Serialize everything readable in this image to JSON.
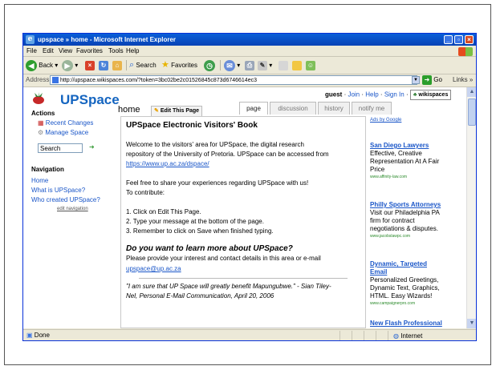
{
  "window": {
    "title": "upspace » home - Microsoft Internet Explorer",
    "controls": [
      "_",
      "▫",
      "×"
    ]
  },
  "menu": [
    "File",
    "Edit",
    "View",
    "Favorites",
    "Tools",
    "Help"
  ],
  "toolbar": {
    "back_label": "Back",
    "search_label": "Search",
    "favorites_label": "Favorites"
  },
  "address": {
    "label": "Address",
    "url": "http://upspace.wikispaces.com/?token=3bc02be2c01526845c873d6746614ec3",
    "go_label": "Go",
    "links_label": "Links »"
  },
  "site": {
    "logo_text": "UPSpace",
    "user": "guest",
    "user_links": [
      "Join",
      "Help",
      "Sign In"
    ],
    "wikispaces_badge": "wikispaces"
  },
  "page": {
    "name": "home",
    "edit_button": "Edit This Page",
    "tabs": [
      "page",
      "discussion",
      "history",
      "notify me"
    ]
  },
  "sidebar": {
    "actions_title": "Actions",
    "actions": [
      "Recent Changes",
      "Manage Space"
    ],
    "search_placeholder": "Search",
    "nav_title": "Navigation",
    "nav_items": [
      "Home",
      "What is UPSpace?",
      "Who created UPSpace?"
    ],
    "edit_nav": "edit navigation"
  },
  "content": {
    "title": "UPSpace Electronic Visitors' Book",
    "p1_l1": "Welcome to the visitors' area for UPSpace, the digital research",
    "p1_l2": "repository of the University of Pretoria. UPSpace can be accessed from",
    "p1_link": "https://www.up.ac.za/dspace/",
    "p2_l1": "Feel free to share your experiences regarding UPSpace with us!",
    "p2_l2": "To contribute:",
    "steps": [
      "1. Click on Edit This Page.",
      "2. Type your message at the bottom of the page.",
      "3. Remember to click on Save when finished typing."
    ],
    "h2": "Do you want to learn more about UPSpace?",
    "p3_l1": "Please provide your interest and contact details in this area or e-mail",
    "p3_link": "upspace@up.ac.za",
    "quote_l1": "\"I am sure that UP Space will greatly benefit Mapungubwe.\" - Sian Tiley-",
    "quote_l2": "Nel, Personal E-Mail Communication, April 20, 2006"
  },
  "ads": {
    "by": "Ads by Google",
    "items": [
      {
        "head": "San Diego Lawyers",
        "lines": [
          "Effective, Creative",
          "Representation At A Fair",
          "Price"
        ],
        "url": "www.affinity-law.com"
      },
      {
        "head": "Philly Sports Attorneys",
        "lines": [
          "Visit our Philadelphia PA",
          "firm for contract",
          "negotiations & disputes."
        ],
        "url": "www.jacobslawpc.com"
      },
      {
        "head_lines": [
          "Dynamic, Targeted",
          "Email"
        ],
        "lines": [
          "Personalized Greetings,",
          "Dynamic Text, Graphics,",
          "HTML. Easy Wizards!"
        ],
        "url": "www.campaignerpro.com"
      },
      {
        "head": "New Flash Professional"
      }
    ]
  },
  "status": {
    "left": "Done",
    "zone": "Internet"
  }
}
